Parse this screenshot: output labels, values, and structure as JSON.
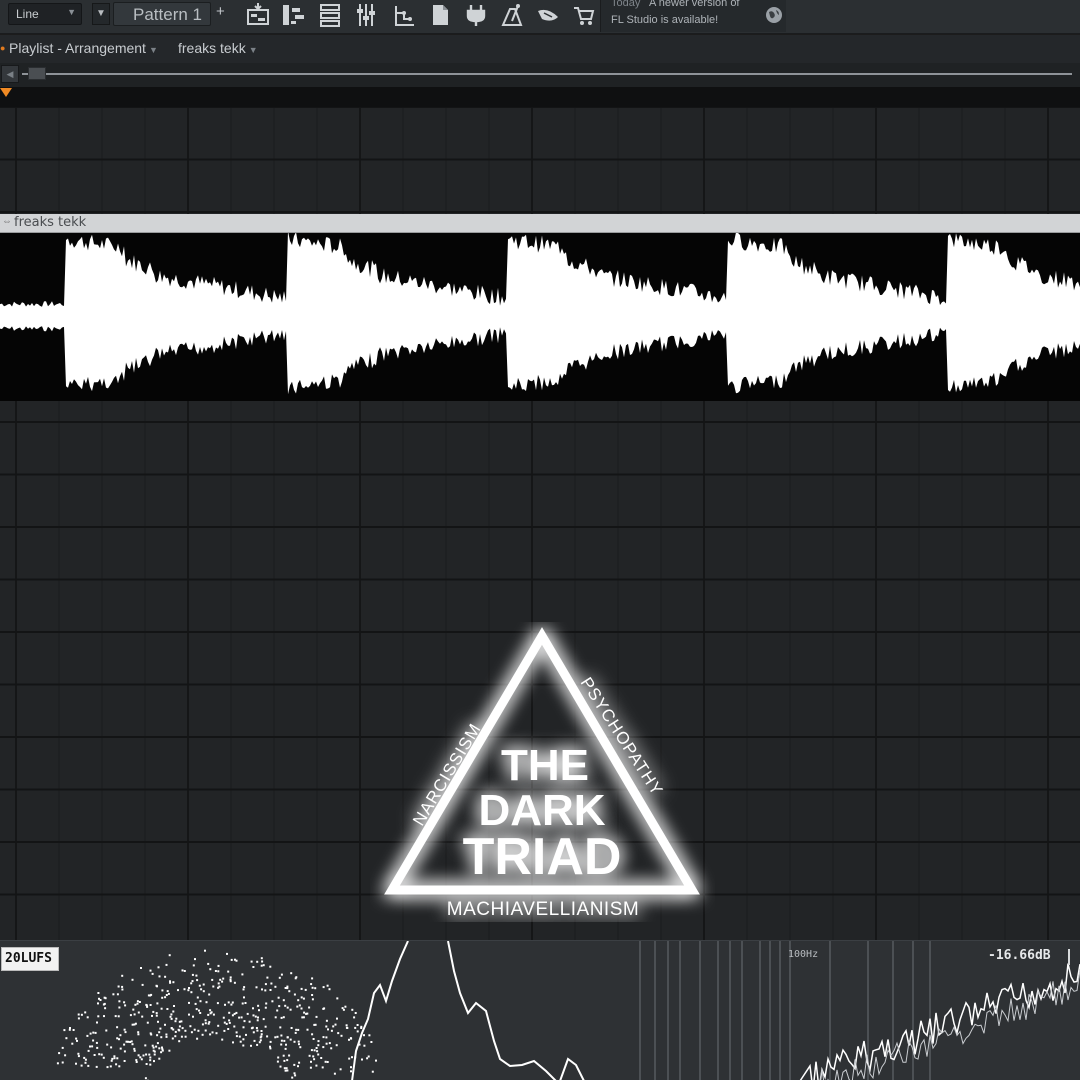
{
  "toolbar": {
    "snap_value": "Line",
    "pattern_label": "Pattern 1",
    "pattern_add": "+",
    "icons": [
      "playlist-icon",
      "piano-roll-icon",
      "channel-rack-icon",
      "mixer-icon",
      "plugin-picker-icon",
      "browser-icon",
      "plugin-database-icon",
      "tempo-icon",
      "send-icon",
      "store-icon"
    ],
    "news_today": "Today",
    "news_line1": "A newer version of",
    "news_line2": "FL Studio is available!"
  },
  "playlist": {
    "window_title": "Playlist - Arrangement",
    "current_pattern": "freaks tekk",
    "clip_name": "freaks tekk"
  },
  "logo": {
    "title_line1": "THE",
    "title_line2": "DARK",
    "title_line3": "TRIAD",
    "left_side": "NARCISSISM",
    "right_side": "PSYCHOPATHY",
    "bottom_side": "MACHIAVELLIANISM"
  },
  "analyzer": {
    "lufs": "20LUFS",
    "freq_marker": "100Hz",
    "db_readout": "-16.66dB"
  },
  "colors": {
    "accent": "#f08a24",
    "background": "#222426",
    "clip_header": "#d2d4d6"
  }
}
